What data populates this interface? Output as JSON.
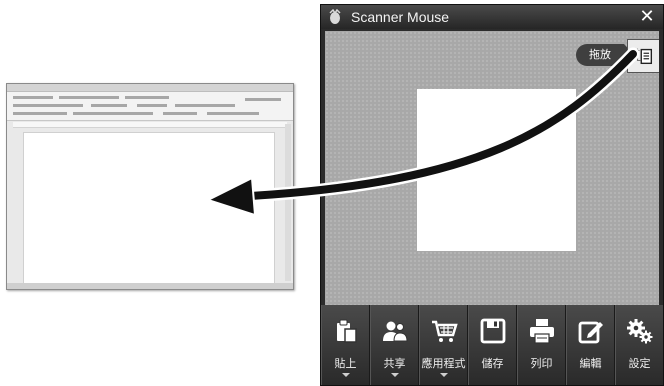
{
  "document": {
    "icon": "document-thumbnail"
  },
  "app": {
    "title": "Scanner Mouse",
    "close_glyph": "✕",
    "drag_label": "拖放",
    "drag_icon": "copy-doc-icon"
  },
  "toolbar": {
    "items": [
      {
        "label": "貼上",
        "icon": "paste-icon",
        "dropdown": true
      },
      {
        "label": "共享",
        "icon": "share-icon",
        "dropdown": true
      },
      {
        "label": "應用程式",
        "icon": "cart-icon",
        "dropdown": true
      },
      {
        "label": "儲存",
        "icon": "save-icon",
        "dropdown": false
      },
      {
        "label": "列印",
        "icon": "print-icon",
        "dropdown": false
      },
      {
        "label": "編輯",
        "icon": "edit-icon",
        "dropdown": false
      },
      {
        "label": "設定",
        "icon": "settings-icon",
        "dropdown": false
      }
    ]
  },
  "colors": {
    "window_bg": "#2b2b2b",
    "preview_bg": "#a8a8a8",
    "arrow": "#111111"
  }
}
